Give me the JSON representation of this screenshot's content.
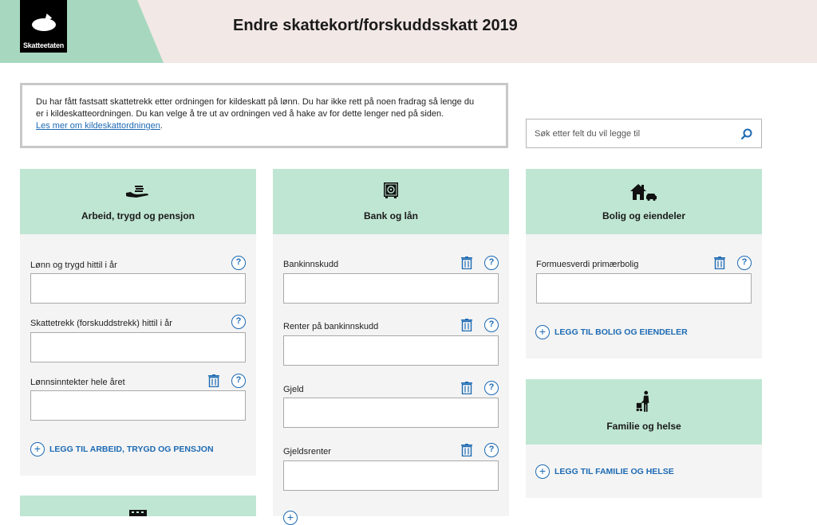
{
  "header": {
    "logo_text": "Skatteetaten",
    "title": "Endre skattekort/forskuddsskatt 2019"
  },
  "notice": {
    "line1": "Du har fått fastsatt skattetrekk etter ordningen for kildeskatt på lønn. Du har ikke rett på noen fradrag så lenge du",
    "line2": "er i kildeskatteordningen. Du kan velge å tre ut av ordningen ved å hake av for dette lenger ned på siden.",
    "link": "Les mer om kildeskattordningen",
    "link_suffix": "."
  },
  "search": {
    "placeholder": "Søk etter felt du vil legge til"
  },
  "cards": {
    "arbeid": {
      "title": "Arbeid, trygd og pensjon",
      "icon": "hand-money-icon",
      "fields": [
        {
          "label": "Lønn og trygd hittil i år",
          "value": ""
        },
        {
          "label": "Skattetrekk (forskuddstrekk) hittil i år",
          "value": ""
        },
        {
          "label": "Lønnsinntekter hele året",
          "value": ""
        }
      ],
      "add_label": "LEGG TIL ARBEID, TRYGD OG PENSJON"
    },
    "bank": {
      "title": "Bank og lån",
      "icon": "safe-icon",
      "fields": [
        {
          "label": "Bankinnskudd",
          "value": ""
        },
        {
          "label": "Renter på bankinnskudd",
          "value": ""
        },
        {
          "label": "Gjeld",
          "value": ""
        },
        {
          "label": "Gjeldsrenter",
          "value": ""
        }
      ]
    },
    "bolig": {
      "title": "Bolig og eiendeler",
      "icon": "house-car-icon",
      "fields": [
        {
          "label": "Formuesverdi primærbolig",
          "value": ""
        }
      ],
      "add_label": "LEGG TIL BOLIG OG EIENDELER"
    },
    "familie": {
      "title": "Familie og helse",
      "icon": "person-stroller-icon",
      "add_label": "LEGG TIL FAMILIE OG HELSE"
    }
  },
  "help_symbol": "?",
  "plus_symbol": "+",
  "colors": {
    "header_bg": "#f2e8e6",
    "header_accent": "#a7d8bf",
    "card_head": "#bfe6d2",
    "card_body": "#f4f4f4",
    "link": "#1c6ab3"
  }
}
